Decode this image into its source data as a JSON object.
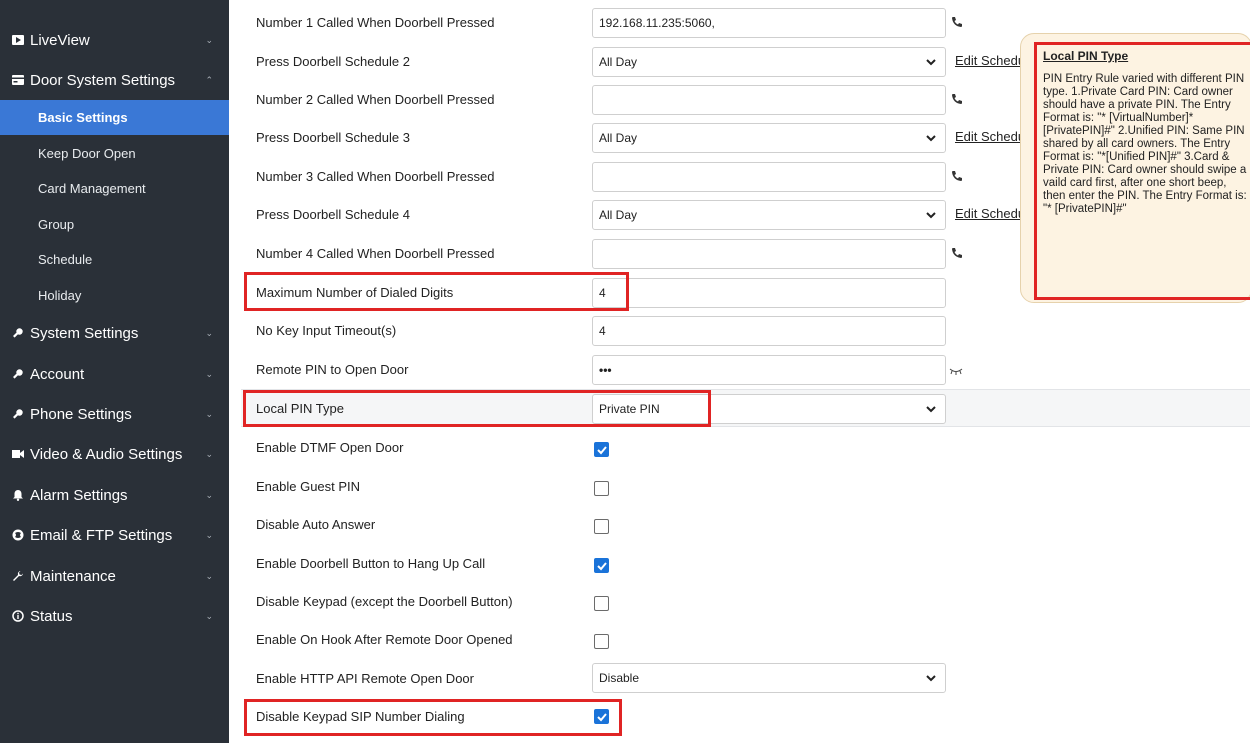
{
  "sidebar": {
    "items": [
      {
        "label": "LiveView",
        "icon": "play-icon"
      },
      {
        "label": "Door System Settings",
        "icon": "card-icon",
        "expanded": true
      },
      {
        "label": "System Settings",
        "icon": "key-icon"
      },
      {
        "label": "Account",
        "icon": "key-icon"
      },
      {
        "label": "Phone Settings",
        "icon": "key-icon"
      },
      {
        "label": "Video & Audio Settings",
        "icon": "video-icon"
      },
      {
        "label": "Alarm Settings",
        "icon": "bell-icon"
      },
      {
        "label": "Email & FTP Settings",
        "icon": "globe-icon"
      },
      {
        "label": "Maintenance",
        "icon": "wrench-icon"
      },
      {
        "label": "Status",
        "icon": "info-icon"
      }
    ],
    "subitems": [
      {
        "label": "Basic Settings",
        "active": true
      },
      {
        "label": "Keep Door Open"
      },
      {
        "label": "Card Management"
      },
      {
        "label": "Group"
      },
      {
        "label": "Schedule"
      },
      {
        "label": "Holiday"
      }
    ]
  },
  "form": {
    "rows": [
      {
        "label": "Number 1 Called When Doorbell Pressed",
        "type": "text",
        "value": "192.168.11.235:5060,",
        "phone": true
      },
      {
        "label": "Press Doorbell Schedule 2",
        "type": "select",
        "value": "All Day",
        "edit": "Edit Schedule"
      },
      {
        "label": "Number 2 Called When Doorbell Pressed",
        "type": "text",
        "value": "",
        "phone": true
      },
      {
        "label": "Press Doorbell Schedule 3",
        "type": "select",
        "value": "All Day",
        "edit": "Edit Schedule"
      },
      {
        "label": "Number 3 Called When Doorbell Pressed",
        "type": "text",
        "value": "",
        "phone": true
      },
      {
        "label": "Press Doorbell Schedule 4",
        "type": "select",
        "value": "All Day",
        "edit": "Edit Schedule"
      },
      {
        "label": "Number 4 Called When Doorbell Pressed",
        "type": "text",
        "value": "",
        "phone": true
      },
      {
        "label": "Maximum Number of Dialed Digits",
        "type": "text",
        "value": "4"
      },
      {
        "label": "No Key Input Timeout(s)",
        "type": "text",
        "value": "4"
      },
      {
        "label": "Remote PIN to Open Door",
        "type": "password",
        "value": "•••"
      },
      {
        "label": "Local PIN Type",
        "type": "select",
        "value": "Private PIN"
      },
      {
        "label": "Enable DTMF Open Door",
        "type": "checkbox",
        "checked": true
      },
      {
        "label": "Enable Guest PIN",
        "type": "checkbox",
        "checked": false
      },
      {
        "label": "Disable Auto Answer",
        "type": "checkbox",
        "checked": false
      },
      {
        "label": "Enable Doorbell Button to Hang Up Call",
        "type": "checkbox",
        "checked": true
      },
      {
        "label": "Disable Keypad (except the Doorbell Button)",
        "type": "checkbox",
        "checked": false
      },
      {
        "label": "Enable On Hook After Remote Door Opened",
        "type": "checkbox",
        "checked": false
      },
      {
        "label": "Enable HTTP API Remote Open Door",
        "type": "select",
        "value": "Disable"
      },
      {
        "label": "Disable Keypad SIP Number Dialing",
        "type": "checkbox",
        "checked": true
      }
    ]
  },
  "tooltip": {
    "title": "Local PIN Type",
    "body": "PIN Entry Rule varied with different PIN type. 1.Private Card PIN: Card owner should have a private PIN. The Entry Format is: \"* [VirtualNumber]*[PrivatePIN]#\" 2.Unified PIN: Same PIN shared by all card owners. The Entry Format is: \"*[Unified PIN]#\" 3.Card & Private PIN: Card owner should swipe a vaild card first, after one short beep, then enter the PIN. The Entry Format is: \"* [PrivatePIN]#\""
  },
  "colors": {
    "sidebar_bg": "#2a3038",
    "active_item": "#3a78d6",
    "checkbox_on": "#1a73d9",
    "highlight_border": "#e02424",
    "tooltip_bg": "#fdf3e2"
  }
}
